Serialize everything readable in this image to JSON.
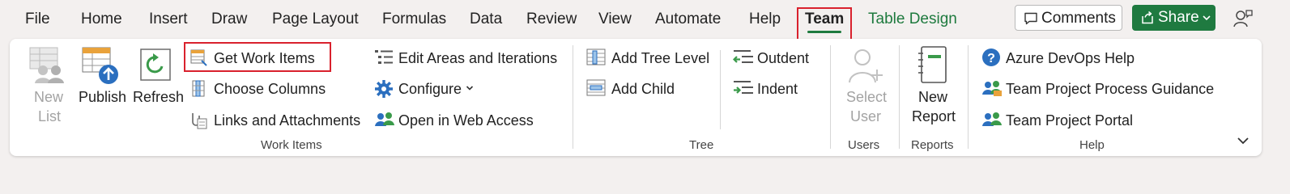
{
  "menu": {
    "tabs": [
      "File",
      "Home",
      "Insert",
      "Draw",
      "Page Layout",
      "Formulas",
      "Data",
      "Review",
      "View",
      "Automate",
      "Help",
      "Team",
      "Table Design"
    ],
    "active_tab": "Team",
    "comments_label": "Comments",
    "share_label": "Share"
  },
  "ribbon": {
    "work_items": {
      "group_label": "Work Items",
      "new_list": [
        "New",
        "List"
      ],
      "publish": "Publish",
      "refresh": "Refresh",
      "get_work_items": "Get Work Items",
      "choose_columns": "Choose Columns",
      "links_attachments": "Links and Attachments",
      "edit_areas": "Edit Areas and Iterations",
      "configure": "Configure",
      "open_web": "Open in Web Access"
    },
    "tree": {
      "group_label": "Tree",
      "add_tree_level": "Add Tree Level",
      "add_child": "Add Child",
      "outdent": "Outdent",
      "indent": "Indent"
    },
    "users": {
      "group_label": "Users",
      "select_user": [
        "Select",
        "User"
      ]
    },
    "reports": {
      "group_label": "Reports",
      "new_report": [
        "New",
        "Report"
      ]
    },
    "help": {
      "group_label": "Help",
      "azure_help": "Azure DevOps Help",
      "process_guidance": "Team Project Process Guidance",
      "portal": "Team Project Portal"
    }
  },
  "colors": {
    "accent_green": "#1e7a3e",
    "share_bg": "#1f7a40",
    "highlight_red": "#d9212d",
    "disabled_text": "#a3a3a3"
  },
  "icons": [
    "new-list-icon",
    "publish-icon",
    "refresh-icon",
    "get-work-items-icon",
    "choose-columns-icon",
    "links-attachments-icon",
    "edit-areas-icon",
    "configure-gear-icon",
    "open-web-access-icon",
    "add-tree-level-icon",
    "add-child-icon",
    "outdent-icon",
    "indent-icon",
    "select-user-icon",
    "new-report-icon",
    "help-question-icon",
    "process-guidance-icon",
    "team-portal-icon",
    "comment-icon",
    "chevron-down-icon",
    "collapse-ribbon-icon",
    "feedback-person-icon"
  ]
}
